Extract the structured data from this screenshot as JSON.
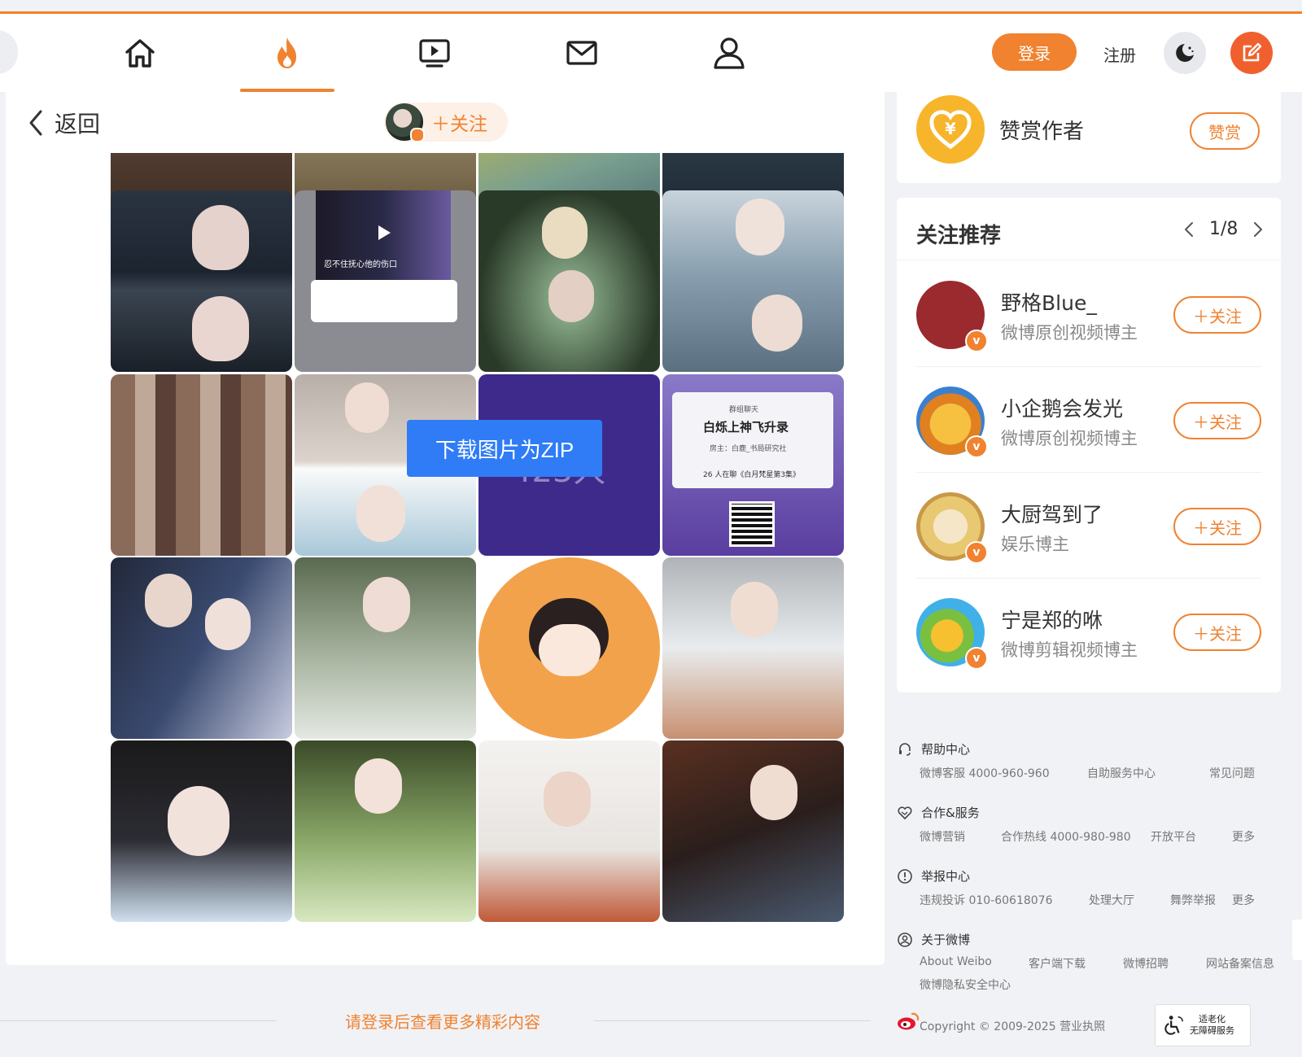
{
  "nav": {
    "tabs": [
      {
        "icon": "home-icon",
        "active": false
      },
      {
        "icon": "hot-flame-icon",
        "active": true
      },
      {
        "icon": "video-icon",
        "active": false
      },
      {
        "icon": "message-icon",
        "active": false
      },
      {
        "icon": "profile-icon",
        "active": false
      }
    ],
    "login_label": "登录",
    "register_label": "注册",
    "theme_icon": "moon-icon",
    "compose_icon": "compose-icon"
  },
  "header": {
    "back_label": "返回",
    "follow_label": "＋关注"
  },
  "gallery": {
    "zip_button_label": "下载图片为ZIP",
    "tile_texts": {
      "chat_title": "白烁上神飞升录",
      "chat_group_label": "群组聊天",
      "chat_owner": "房主：白鹿_书局研究社",
      "chat_count": "26 人在聊《白月梵星第3集》",
      "members_count": "423人",
      "video_caption": "忍不住抚心他的伤口"
    }
  },
  "reward": {
    "label": "赞赏作者",
    "button_label": "赞赏"
  },
  "recommend": {
    "title": "关注推荐",
    "page_indicator": "1/8",
    "follow_label": "＋关注",
    "items": [
      {
        "name": "野格Blue_",
        "desc": "微博原创视频博主",
        "avatar_color": "#9a2a2e"
      },
      {
        "name": "小企鹅会发光",
        "desc": "微博原创视频博主",
        "avatar_color": "#f0a020"
      },
      {
        "name": "大厨驾到了",
        "desc": "娱乐博主",
        "avatar_color": "#e8d8a0"
      },
      {
        "name": "宁是郑的咻",
        "desc": "微博剪辑视频博主",
        "avatar_color": "#3ab0e8"
      }
    ]
  },
  "footer": {
    "help": {
      "title": "帮助中心",
      "links": [
        "微博客服 4000-960-960",
        "自助服务中心",
        "常见问题"
      ]
    },
    "coop": {
      "title": "合作&服务",
      "links": [
        "微博营销",
        "合作热线 4000-980-980",
        "开放平台",
        "更多"
      ]
    },
    "report": {
      "title": "举报中心",
      "links": [
        "违规投诉 010-60618076",
        "处理大厅",
        "舞弊举报",
        "更多"
      ]
    },
    "about": {
      "title": "关于微博",
      "links": [
        "About Weibo",
        "客户端下载",
        "微博招聘",
        "网站备案信息",
        "微博隐私安全中心"
      ]
    },
    "copyright": "Copyright © 2009-2025 营业执照",
    "a11y_line1": "适老化",
    "a11y_line2": "无障碍服务"
  },
  "login_more": "请登录后查看更多精彩内容",
  "colors": {
    "accent": "#f08230",
    "zip_blue": "#2f7cf6"
  }
}
